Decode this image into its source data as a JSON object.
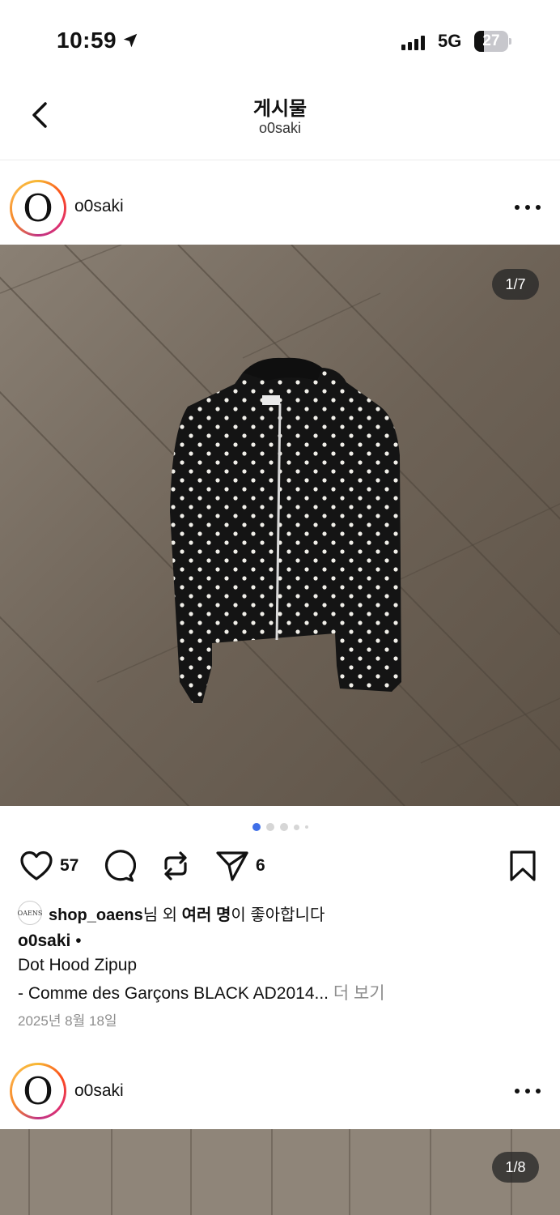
{
  "status_bar": {
    "time": "10:59",
    "network": "5G",
    "battery": "27"
  },
  "header": {
    "title": "게시물",
    "subtitle": "o0saki"
  },
  "posts": [
    {
      "username": "o0saki",
      "avatar_letter": "O",
      "counter": "1/7",
      "likes_count": "57",
      "shares_count": "6",
      "liked_by_user": "shop_oaens",
      "liked_by_avatar_text": "OAENS",
      "liked_by_rest": "님 외 ",
      "liked_by_many": "여러 명",
      "liked_by_tail": "이 좋아합니다",
      "caption_user": "o0saki",
      "caption_bullet": " •",
      "caption_line1": "Dot Hood Zipup",
      "caption_line2": "- Comme des Garçons BLACK AD2014...",
      "more_label": " 더 보기",
      "date": "2025년 8월 18일"
    },
    {
      "username": "o0saki",
      "avatar_letter": "O",
      "counter": "1/8"
    }
  ],
  "icons": {
    "back": "chevron-left-icon",
    "location": "location-arrow-icon",
    "more": "more-horizontal-icon",
    "like": "heart-icon",
    "comment": "comment-icon",
    "repost": "repost-icon",
    "share": "send-icon",
    "save": "bookmark-icon"
  },
  "colors": {
    "accent_dot": "#3f6fe8",
    "muted_text": "#8e8e8e"
  }
}
